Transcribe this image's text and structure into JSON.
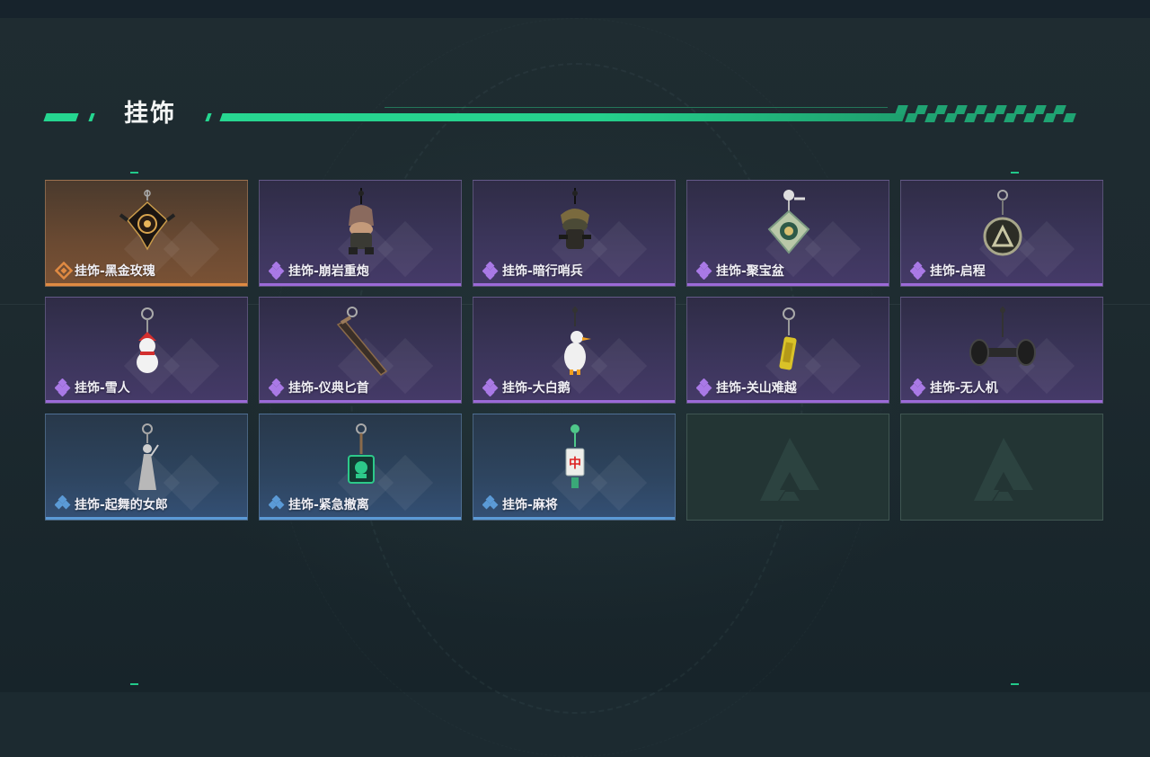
{
  "header": {
    "title": "挂饰"
  },
  "colors": {
    "accent": "#25d690",
    "rarity_legendary": "#e08a42",
    "rarity_epic": "#9c6ad8",
    "rarity_rare": "#5b9ad6"
  },
  "items": [
    {
      "label": "挂饰-黑金玫瑰",
      "rarity": "legendary",
      "icon": "black-gold-rose-charm-icon"
    },
    {
      "label": "挂饰-崩岩重炮",
      "rarity": "epic",
      "icon": "rock-cannon-soldier-charm-icon"
    },
    {
      "label": "挂饰-暗行哨兵",
      "rarity": "epic",
      "icon": "shadow-sentinel-charm-icon"
    },
    {
      "label": "挂饰-聚宝盆",
      "rarity": "epic",
      "icon": "treasure-bowl-charm-icon"
    },
    {
      "label": "挂饰-启程",
      "rarity": "epic",
      "icon": "departure-medal-charm-icon"
    },
    {
      "label": "挂饰-雪人",
      "rarity": "epic",
      "icon": "snowman-charm-icon"
    },
    {
      "label": "挂饰-仪典匕首",
      "rarity": "epic",
      "icon": "ceremonial-dagger-charm-icon"
    },
    {
      "label": "挂饰-大白鹅",
      "rarity": "epic",
      "icon": "white-goose-charm-icon"
    },
    {
      "label": "挂饰-关山难越",
      "rarity": "epic",
      "icon": "gold-bar-charm-icon"
    },
    {
      "label": "挂饰-无人机",
      "rarity": "epic",
      "icon": "drone-charm-icon"
    },
    {
      "label": "挂饰-起舞的女郎",
      "rarity": "rare",
      "icon": "dancing-lady-charm-icon"
    },
    {
      "label": "挂饰-紧急撤离",
      "rarity": "rare",
      "icon": "emergency-evac-charm-icon"
    },
    {
      "label": "挂饰-麻将",
      "rarity": "rare",
      "icon": "mahjong-tile-charm-icon"
    }
  ],
  "empty_slots": [
    {
      "icon": "game-logo-placeholder-icon"
    },
    {
      "icon": "game-logo-placeholder-icon"
    }
  ]
}
